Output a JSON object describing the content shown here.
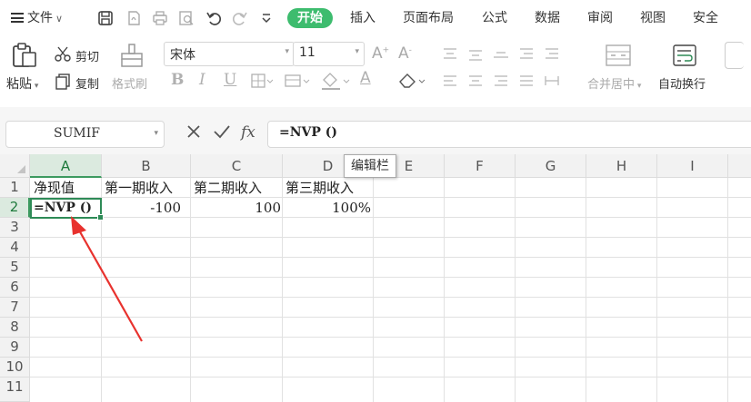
{
  "menu": {
    "file_label": "文件",
    "tabs": [
      "开始",
      "插入",
      "页面布局",
      "公式",
      "数据",
      "审阅",
      "视图",
      "安全"
    ]
  },
  "ribbon": {
    "paste": "粘贴",
    "cut": "剪切",
    "copy": "复制",
    "format_painter": "格式刷",
    "font_name": "宋体",
    "font_size": "11",
    "merge_center": "合并居中",
    "wrap_text": "自动换行"
  },
  "formula_bar": {
    "name_box": "SUMIF",
    "fx": "fx",
    "formula": "=NVP ()",
    "tooltip": "编辑栏"
  },
  "sheet": {
    "columns": [
      "A",
      "B",
      "C",
      "D",
      "E",
      "F",
      "G",
      "H",
      "I"
    ],
    "rows": [
      "1",
      "2",
      "3",
      "4",
      "5",
      "6",
      "7",
      "8",
      "9",
      "10",
      "11"
    ],
    "cells": {
      "A1": "净现值",
      "B1": "第一期收入",
      "C1": "第二期收入",
      "D1": "第三期收入",
      "A2": "=NVP ()",
      "B2": "-100",
      "C2": "100",
      "D2": "100%"
    },
    "selected_cell": "A2"
  },
  "colors": {
    "accent_green": "#3dbc6e",
    "selection_green": "#2e8b57",
    "annotation_red": "#e8322e"
  }
}
